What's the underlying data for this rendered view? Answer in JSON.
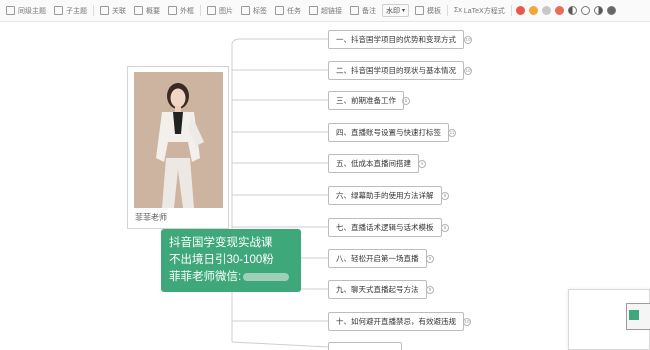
{
  "toolbar": {
    "items": [
      "同级主题",
      "子主题",
      "关联",
      "概要",
      "外框",
      "图片",
      "标签",
      "任务",
      "超链接",
      "备注"
    ],
    "layout_select": "水印",
    "template_label": "模板",
    "latex_label": "LaTeX方程式",
    "colors": [
      "#e8594b",
      "#f2a53b",
      "#c8c8c8",
      "#eb6b57"
    ]
  },
  "root": {
    "line1": "抖音国学变现实战课",
    "line2": "不出境日引30-100粉",
    "line3": "菲菲老师微信:"
  },
  "image_node": {
    "caption": "菲菲老师"
  },
  "topics": [
    {
      "label": "一、抖音国学项目的优势和变现方式",
      "count": "10"
    },
    {
      "label": "二、抖音国学项目的现状与基本情况",
      "count": "10"
    },
    {
      "label": "三、前期准备工作",
      "count": "5"
    },
    {
      "label": "四、直播账号设置与快速打标签",
      "count": "11"
    },
    {
      "label": "五、低成本直播间搭建",
      "count": "4"
    },
    {
      "label": "六、绿幕助手的使用方法详解",
      "count": "8"
    },
    {
      "label": "七、直播话术逻辑与话术模板",
      "count": "5"
    },
    {
      "label": "八、轻松开启第一场直播",
      "count": "9"
    },
    {
      "label": "九、聊天式直播起号方法",
      "count": "9"
    },
    {
      "label": "十、如何避开直播禁忌，有效避违规",
      "count": "10"
    }
  ]
}
